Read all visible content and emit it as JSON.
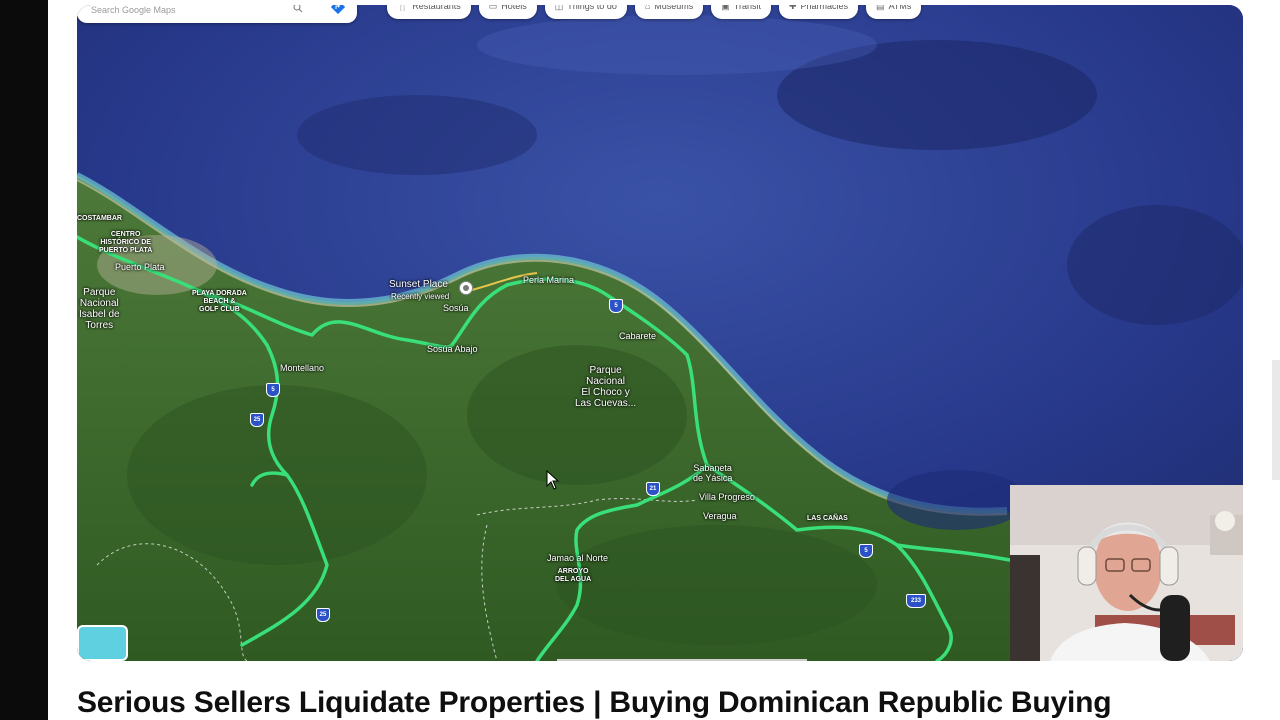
{
  "video": {
    "title": "Serious Sellers Liquidate Properties | Buying Dominican Republic Buying"
  },
  "map": {
    "search_placeholder": "Search Google Maps",
    "chips": [
      {
        "icon": "restaurant-icon",
        "label": "Restaurants"
      },
      {
        "icon": "hotel-icon",
        "label": "Hotels"
      },
      {
        "icon": "camera-icon",
        "label": "Things to do"
      },
      {
        "icon": "museum-icon",
        "label": "Museums"
      },
      {
        "icon": "transit-icon",
        "label": "Transit"
      },
      {
        "icon": "pharmacy-icon",
        "label": "Pharmacies"
      },
      {
        "icon": "atm-icon",
        "label": "ATMs"
      }
    ],
    "labels": {
      "costambar": "COSTAMBAR",
      "centro": "CENTRO\nHISTÓRICO DE\nPUERTO PLATA",
      "puerto_plata": "Puerto Plata",
      "parque_isabel": "Parque\nNacional\nIsabel de\nTorres",
      "playa_dorada": "PLAYA DORADA\nBEACH &\nGOLF CLUB",
      "sunset_place": "Sunset Place",
      "recently_viewed": "Recently viewed",
      "sosua": "Sosúa",
      "perla_marina": "Perla Marina",
      "cabarete": "Cabarete",
      "montellano": "Montellano",
      "sosua_abajo": "Sosúa Abajo",
      "parque_choco": "Parque\nNacional\nEl Choco y\nLas Cuevas...",
      "sabaneta": "Sabaneta\nde Yásica",
      "villa_progreso": "Villa Progreso",
      "veragua": "Veragua",
      "las_canas": "LAS CAÑAS",
      "jamao": "Jamao al Norte",
      "arroyo": "ARROYO\nDEL AGUA"
    },
    "shields": {
      "s1": "5",
      "s2": "25",
      "s3": "5",
      "s4": "21",
      "s5": "5",
      "s6": "25",
      "s7": "233"
    },
    "colors": {
      "ocean": "#2b3f8a",
      "land": "#3e6b2c",
      "route": "#39e07a",
      "shield": "#2b53c7"
    }
  }
}
